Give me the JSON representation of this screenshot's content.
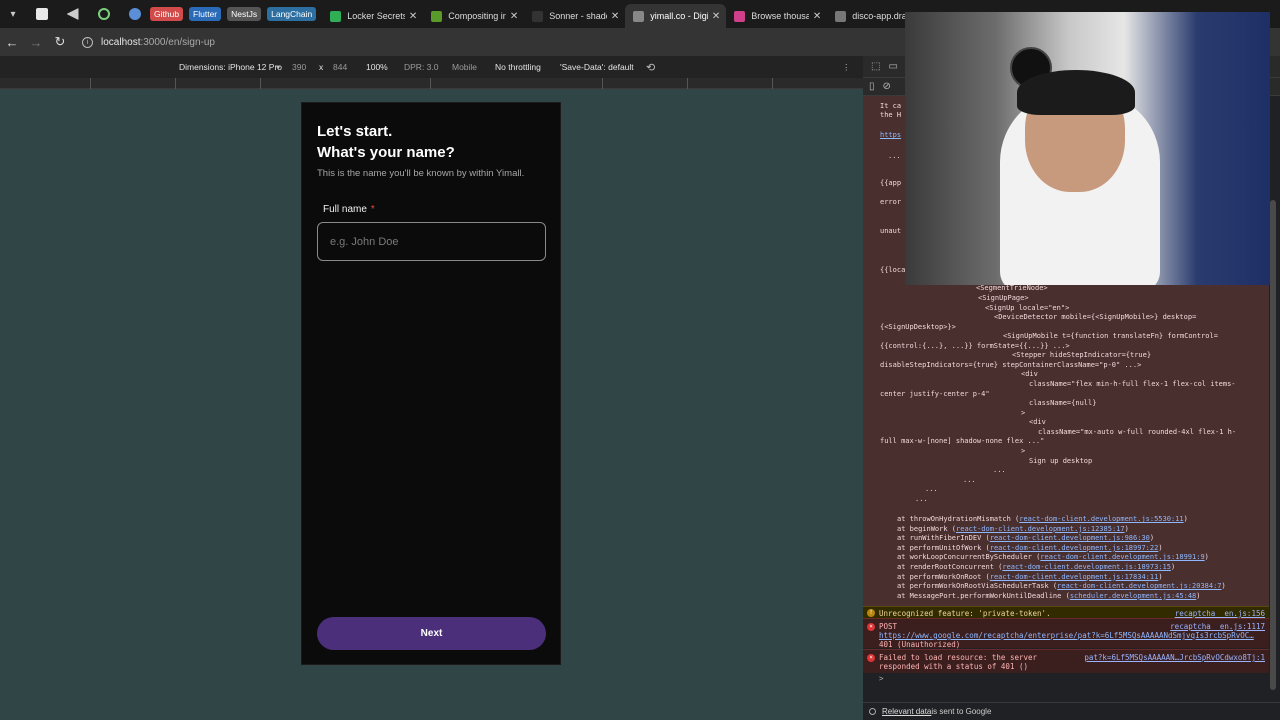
{
  "tabs": {
    "bookmarks": [
      {
        "label": "Github",
        "color": "#d24b4b"
      },
      {
        "label": "Flutter",
        "color": "#2b6ab6"
      },
      {
        "label": "NestJs",
        "color": "#555555"
      },
      {
        "label": "LangChain",
        "color": "#2c6fa0"
      }
    ],
    "items": [
      {
        "title": "Locker Secrets",
        "active": false,
        "fav": "#2fae55"
      },
      {
        "title": "Compositing in",
        "active": false,
        "fav": "#5a9a2a"
      },
      {
        "title": "Sonner - shadc",
        "active": false,
        "fav": "#333333"
      },
      {
        "title": "yimall.co - Digi",
        "active": true,
        "fav": "#888888"
      },
      {
        "title": "Browse thousa",
        "active": false,
        "fav": "#d0408a"
      },
      {
        "title": "disco-app.dra",
        "active": false,
        "fav": "#777777"
      }
    ]
  },
  "address": {
    "host": "localhost",
    "path": ":3000/en/sign-up"
  },
  "device_toolbar": {
    "dimensions": "Dimensions: iPhone 12 Pro",
    "width": "390",
    "x": "x",
    "height": "844",
    "zoom": "100%",
    "dpr": "DPR: 3.0",
    "mode": "Mobile",
    "throttling": "No throttling",
    "save_data": "'Save-Data': default"
  },
  "signup": {
    "heading_line1": "Let's start.",
    "heading_line2": "What's your name?",
    "subtitle": "This is the name you'll be known by within Yimall.",
    "label": "Full name",
    "required_mark": "*",
    "placeholder": "e.g. John Doe",
    "next_label": "Next"
  },
  "console": {
    "top_lines": [
      "It ca",
      "the H",
      "https",
      "...",
      "{{app",
      "error",
      "unaut",
      "{{loca"
    ],
    "tree_lines": [
      "<SegmentTrieNode>",
      "<SignUpPage>",
      "<SignUp locale=\"en\">",
      "<DeviceDetector mobile={<SignUpMobile>} desktop=",
      "{<SignUpDesktop>}>",
      "<SignUpMobile t={function translateFn} formControl=",
      "{{control:{...}, ...}} formState={{...}} ...>",
      "<Stepper hideStepIndicator={true}",
      "disableStepIndicators={true} stepContainerClassName=\"p-0\" ...>",
      "<div",
      "className=\"flex min-h-full flex-1 flex-col items-",
      "center justify-center p-4\"",
      "className={null}",
      ">",
      "<div",
      "className=\"mx-auto w-full rounded-4xl flex-1 h-",
      "full max-w-[none] shadow-none flex ...\"",
      ">",
      "Sign up desktop",
      "...",
      "...",
      "...",
      "..."
    ],
    "stack": [
      {
        "fn": "at throwOnHydrationMismatch",
        "src": "react-dom-client.development.js:5530:11"
      },
      {
        "fn": "at beginWork",
        "src": "react-dom-client.development.js:12385:17"
      },
      {
        "fn": "at runWithFiberInDEV",
        "src": "react-dom-client.development.js:986:30"
      },
      {
        "fn": "at performUnitOfWork",
        "src": "react-dom-client.development.js:18997:22"
      },
      {
        "fn": "at workLoopConcurrentByScheduler",
        "src": "react-dom-client.development.js:18991:9"
      },
      {
        "fn": "at renderRootConcurrent",
        "src": "react-dom-client.development.js:18973:15"
      },
      {
        "fn": "at performWorkOnRoot",
        "src": "react-dom-client.development.js:17834:11"
      },
      {
        "fn": "at performWorkOnRootViaSchedulerTask",
        "src": "react-dom-client.development.js:20384:7"
      },
      {
        "fn": "at MessagePort.performWorkUntilDeadline",
        "src": "scheduler.development.js:45:48"
      }
    ],
    "warning": {
      "text": "Unrecognized feature: 'private-token'.",
      "src": "recaptcha__en.js:156"
    },
    "error1": {
      "head": "POST",
      "src": "recaptcha__en.js:1117",
      "url": "https://www.google.com/recaptcha/enterprise/pat?k=6Lf5MSQsAAAAANdSmjvqIs3rcbSpRvOC…",
      "status": "401 (Unauthorized)"
    },
    "error2": {
      "line1": "Failed to load resource: the server",
      "line2": "responded with a status of 401 ()",
      "src": "pat?k=6Lf5MSQsAAAAAN…JrcbSpRvOCdwxo8Tj:1"
    },
    "prompt": ">"
  },
  "footer": {
    "link": "Relevant data",
    "text": " is sent to Google"
  }
}
